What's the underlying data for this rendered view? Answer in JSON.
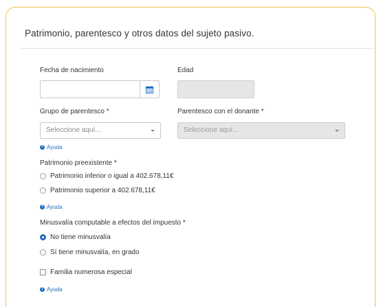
{
  "section_title": "Patrimonio, parentesco y otros datos del sujeto pasivo.",
  "birthdate": {
    "label": "Fecha de nacimiento",
    "value": "",
    "icon": "calendar-icon"
  },
  "age": {
    "label": "Edad",
    "value": ""
  },
  "kinship_group": {
    "label": "Grupo de parentesco *",
    "selected": "Seleccione aquí...",
    "help": "Ayuda"
  },
  "kinship_donor": {
    "label": "Parentesco con el donante *",
    "selected": "Seleccione aquí...",
    "disabled": true
  },
  "prior_wealth": {
    "label": "Patrimonio preexistente *",
    "options": [
      {
        "label": "Patrimonio inferior o igual a 402.678,11€",
        "checked": false
      },
      {
        "label": "Patrimonio superior a 402.678,11€",
        "checked": false
      }
    ],
    "help": "Ayuda"
  },
  "disability": {
    "label": "Minusvalía computable a efectos del impuesto *",
    "options": [
      {
        "label": "No tiene minusvalía",
        "checked": true
      },
      {
        "label": "Sí tiene minusvalía, en grado",
        "checked": false
      }
    ]
  },
  "large_family": {
    "label": "Familia numerosa especial",
    "checked": false,
    "help": "Ayuda"
  },
  "colors": {
    "accent": "#f5bf45",
    "link": "#1f6fc5",
    "disabled_bg": "#e6e6e6"
  }
}
